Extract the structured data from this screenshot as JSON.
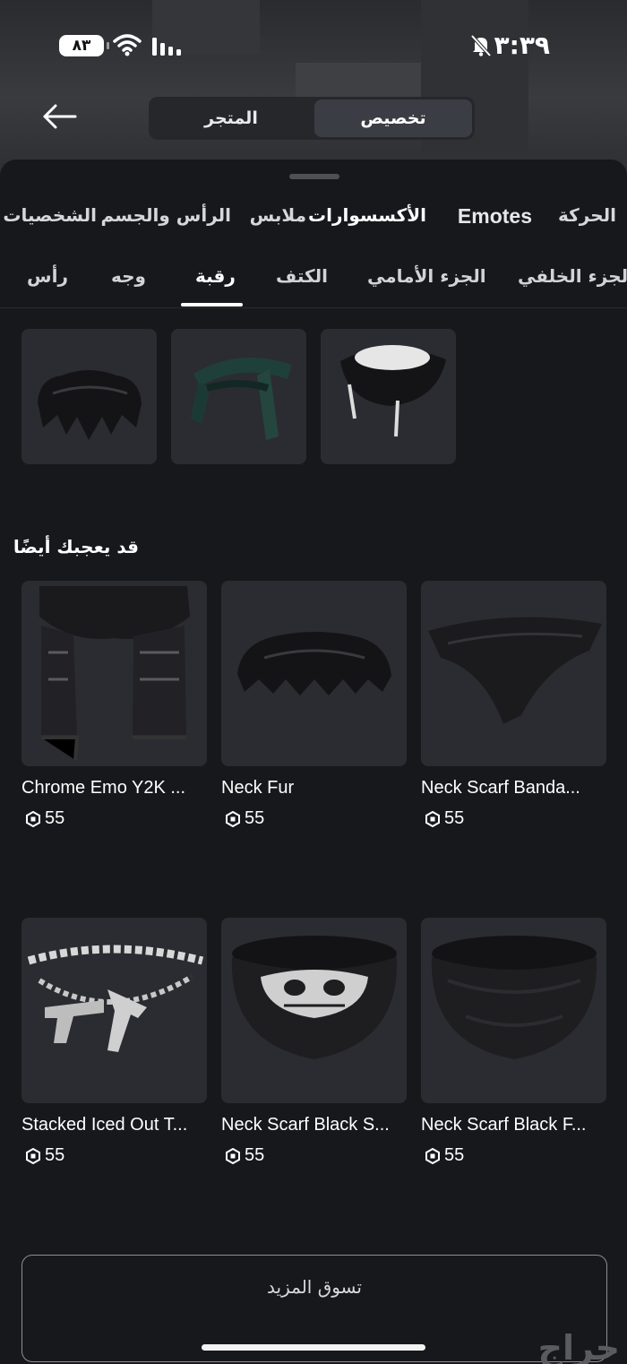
{
  "status_bar": {
    "time": "٣:٣٩",
    "battery": "٨٣",
    "icons": [
      "bell-off-icon",
      "wifi-icon",
      "signal-icon",
      "battery-icon"
    ]
  },
  "top_nav": {
    "back_icon": "arrow-left-icon",
    "segments": {
      "store": "المتجر",
      "customize": "تخصيص"
    },
    "selected": "تخصيص"
  },
  "categories": [
    "الحركة",
    "Emotes",
    "الأكسسوارات",
    "ملابس",
    "الرأس والجسم",
    "الشخصيات"
  ],
  "selected_category": "الأكسسوارات",
  "subcategories": [
    "الجزء الخلفي",
    "الجزء الأمامي",
    "الكتف",
    "رقبة",
    "وجه",
    "رأس"
  ],
  "selected_subcategory": "رقبة",
  "equipped_items": [
    "neck-fur-item",
    "green-scarf-item",
    "white-hood-item"
  ],
  "recommended": {
    "title": "قد يعجبك أيضًا",
    "items": [
      {
        "name": "Chrome Emo Y2K ...",
        "price": "55"
      },
      {
        "name": "Neck Fur",
        "price": "55"
      },
      {
        "name": "Neck Scarf Banda...",
        "price": "55"
      },
      {
        "name": "Stacked Iced Out T...",
        "price": "55"
      },
      {
        "name": "Neck Scarf Black S...",
        "price": "55"
      },
      {
        "name": "Neck Scarf Black F...",
        "price": "55"
      }
    ]
  },
  "shop_more": "تسوق المزيد",
  "watermark": "حراج",
  "colors": {
    "background": "#17181c",
    "tile": "#2b2c31",
    "accent": "#ffffff"
  }
}
